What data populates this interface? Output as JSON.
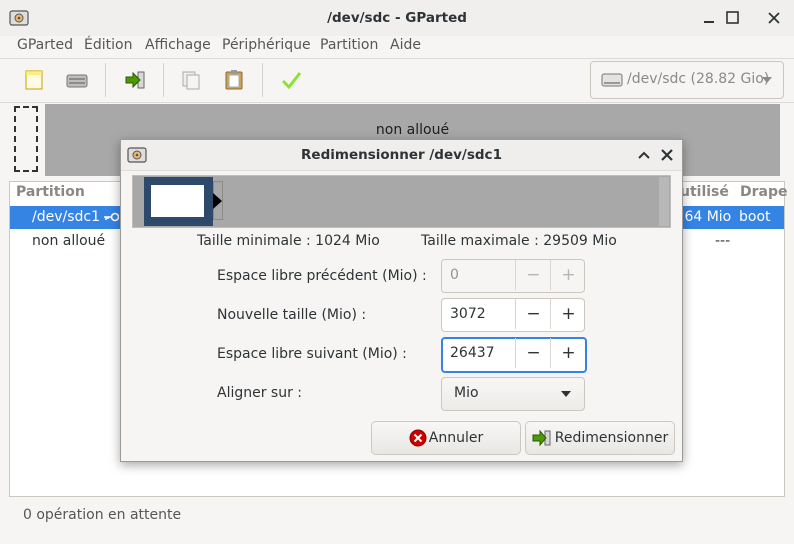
{
  "window": {
    "title": "/dev/sdc - GParted",
    "minimize_label": "_",
    "restore_label": "❐",
    "close_label": "✕",
    "app_icon": "gparted-icon"
  },
  "menu": [
    "GParted",
    "Édition",
    "Affichage",
    "Périphérique",
    "Partition",
    "Aide"
  ],
  "toolbar": {
    "icons": [
      "new-partition-icon",
      "delete-partition-icon",
      "resize-move-icon",
      "copy-icon",
      "paste-icon",
      "apply-icon"
    ],
    "device": "/dev/sdc (28.82 Gio)",
    "device_icon": "drive-icon"
  },
  "graph": {
    "unallocated_label": "non alloué"
  },
  "list": {
    "columns": [
      "Partition",
      "utilisé",
      "Drape"
    ],
    "rows": [
      {
        "partition": "/dev/sdc1",
        "used": ".64 Mio",
        "flags": "boot",
        "selected": true,
        "key_icon": "key-icon"
      },
      {
        "partition": "non alloué",
        "used": "",
        "flags": "---",
        "selected": false
      }
    ]
  },
  "status": "0 opération en attente",
  "dialog": {
    "title": "Redimensionner /dev/sdc1",
    "min_size": "Taille minimale : 1024 Mio",
    "max_size": "Taille maximale : 29509 Mio",
    "free_before_label": "Espace libre précédent (Mio) :",
    "free_before_value": "0",
    "new_size_label": "Nouvelle taille (Mio) :",
    "new_size_value": "3072",
    "free_after_label": "Espace libre suivant (Mio) :",
    "free_after_value": "26437",
    "align_label": "Aligner sur :",
    "align_value": "Mio",
    "cancel_label": "Annuler",
    "resize_label": "Redimensionner",
    "minus": "−",
    "plus": "+",
    "collapse_label": "⌃",
    "close_label": "✕"
  },
  "colors": {
    "selection": "#3584e4",
    "unallocated": "#a8a8a8",
    "partition_fill": "#2e4a6a"
  }
}
